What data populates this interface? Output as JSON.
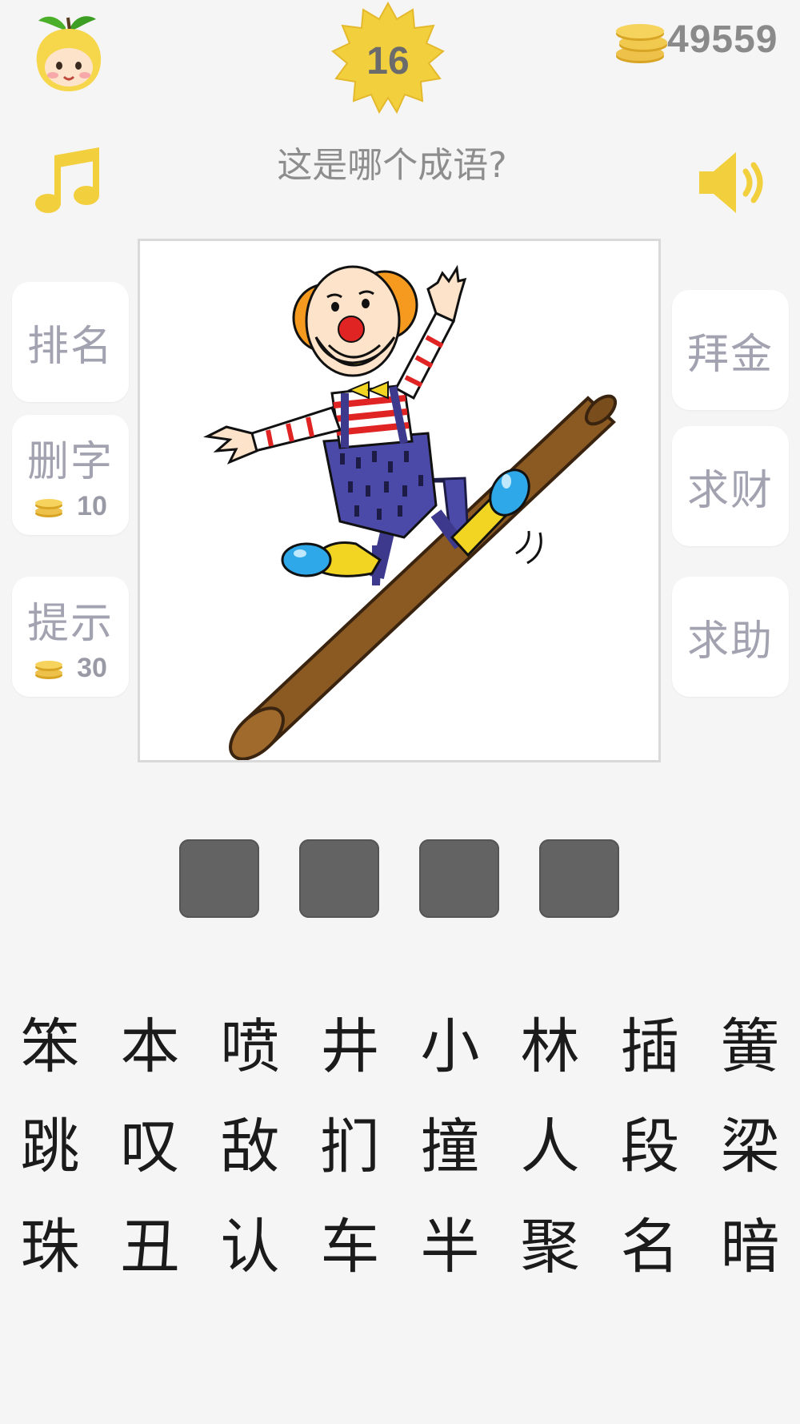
{
  "header": {
    "level": "16",
    "coins": "49559"
  },
  "question": "这是哪个成语?",
  "left_buttons": [
    {
      "label": "排名",
      "cost": ""
    },
    {
      "label": "删字",
      "cost": "10"
    },
    {
      "label": "提示",
      "cost": "30"
    }
  ],
  "right_buttons": [
    {
      "label": "拜金"
    },
    {
      "label": "求财"
    },
    {
      "label": "求助"
    }
  ],
  "answer_slots": [
    "",
    "",
    "",
    ""
  ],
  "chars": [
    [
      "笨",
      "本",
      "喷",
      "井",
      "小",
      "林",
      "插",
      "簧"
    ],
    [
      "跳",
      "叹",
      "敌",
      "扪",
      "撞",
      "人",
      "段",
      "梁"
    ],
    [
      "珠",
      "丑",
      "认",
      "车",
      "半",
      "聚",
      "名",
      "暗"
    ]
  ],
  "colors": {
    "background": "#f5f5f5",
    "badge": "#f2cf3d",
    "coin": "#e8b92e",
    "slot": "#636363",
    "side_label": "#a2a2b0"
  },
  "icons": {
    "avatar": "pear-face-icon",
    "level": "starburst-badge-icon",
    "coins": "coin-stack-icon",
    "music": "music-note-icon",
    "speaker": "speaker-icon"
  }
}
